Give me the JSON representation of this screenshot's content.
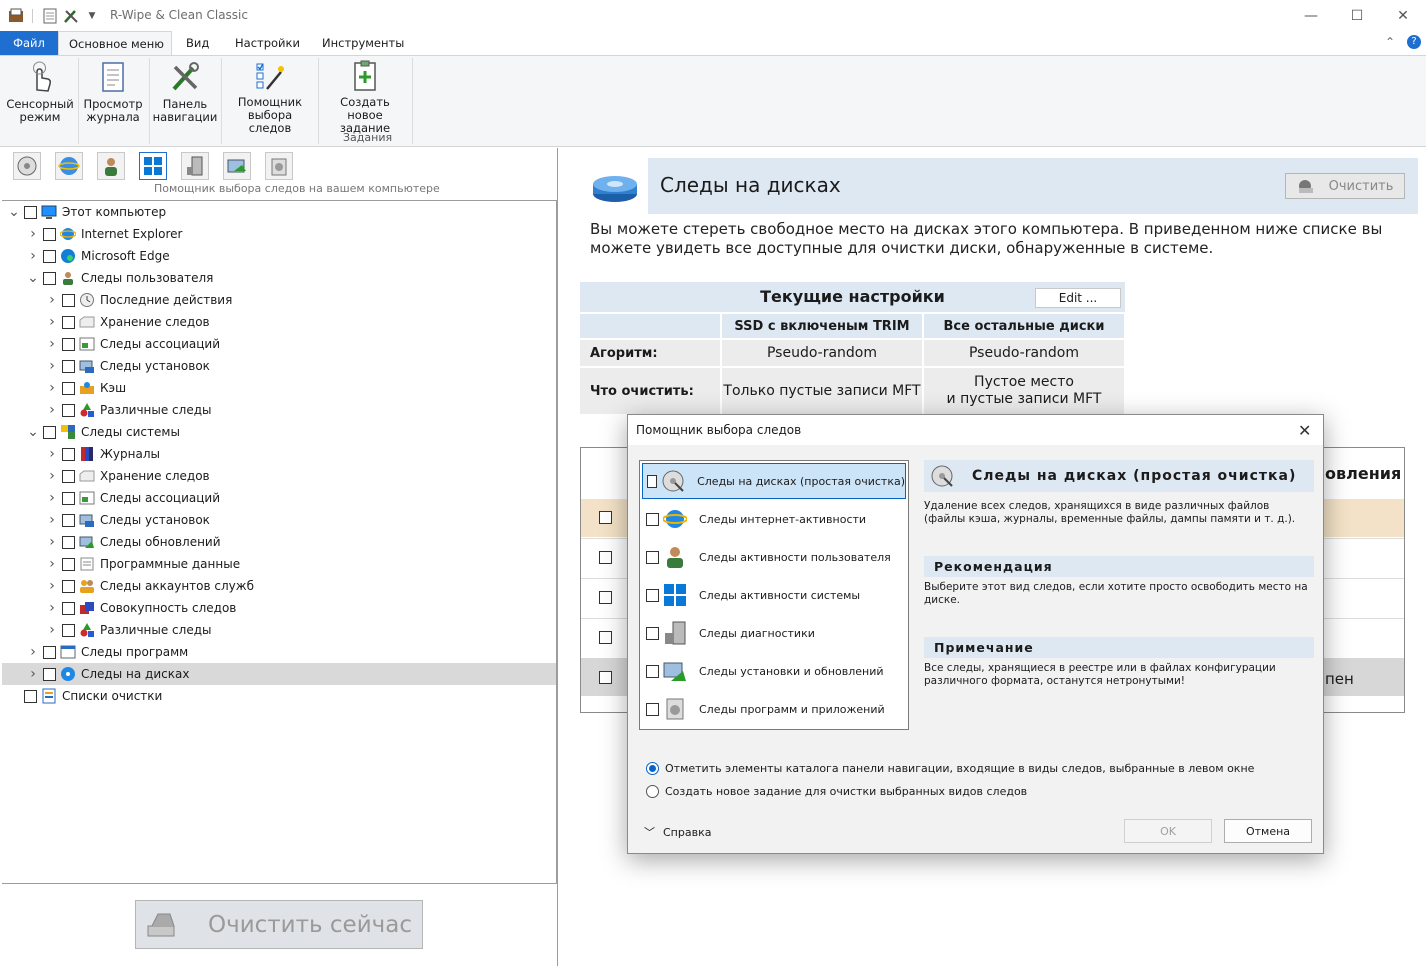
{
  "window": {
    "title": "R-Wipe & Clean Classic"
  },
  "ribbon_tabs": [
    "Файл",
    "Основное меню",
    "Вид",
    "Настройки",
    "Инструменты"
  ],
  "ribbon": {
    "buttons": [
      {
        "l1": "Сенсорный",
        "l2": "режим"
      },
      {
        "l1": "Просмотр",
        "l2": "журнала"
      },
      {
        "l1": "Панель",
        "l2": "навигации"
      },
      {
        "l1": "Помощник",
        "l2": "выбора следов"
      },
      {
        "l1": "Создать новое",
        "l2": "задание"
      }
    ],
    "group_label": "Задания"
  },
  "toolbar_hint": "Помощник выбора следов на вашем компьютере",
  "tree": [
    {
      "label": "Этот компьютер",
      "level": 0,
      "chev": "v",
      "icon": "monitor-icon"
    },
    {
      "label": "Internet  Explorer",
      "level": 1,
      "chev": ">",
      "icon": "ie-icon"
    },
    {
      "label": "Microsoft Edge",
      "level": 1,
      "chev": ">",
      "icon": "edge-icon"
    },
    {
      "label": "Следы пользователя",
      "level": 1,
      "chev": "v",
      "icon": "user-icon"
    },
    {
      "label": "Последние действия",
      "level": 2,
      "chev": ">",
      "icon": "clock-icon"
    },
    {
      "label": "Хранение следов",
      "level": 2,
      "chev": ">",
      "icon": "storage-icon"
    },
    {
      "label": "Следы ассоциаций",
      "level": 2,
      "chev": ">",
      "icon": "assoc-icon"
    },
    {
      "label": "Следы установок",
      "level": 2,
      "chev": ">",
      "icon": "install-icon"
    },
    {
      "label": "Кэш",
      "level": 2,
      "chev": ">",
      "icon": "cache-icon"
    },
    {
      "label": "Различные следы",
      "level": 2,
      "chev": ">",
      "icon": "misc-icon"
    },
    {
      "label": "Следы системы",
      "level": 1,
      "chev": "v",
      "icon": "system-icon"
    },
    {
      "label": "Журналы",
      "level": 2,
      "chev": ">",
      "icon": "logs-icon"
    },
    {
      "label": "Хранение следов",
      "level": 2,
      "chev": ">",
      "icon": "storage-icon"
    },
    {
      "label": "Следы ассоциаций",
      "level": 2,
      "chev": ">",
      "icon": "assoc-icon"
    },
    {
      "label": "Следы установок",
      "level": 2,
      "chev": ">",
      "icon": "install-icon"
    },
    {
      "label": "Следы обновлений",
      "level": 2,
      "chev": ">",
      "icon": "update-icon"
    },
    {
      "label": "Программные данные",
      "level": 2,
      "chev": ">",
      "icon": "progdata-icon"
    },
    {
      "label": "Следы аккаунтов служб",
      "level": 2,
      "chev": ">",
      "icon": "accounts-icon"
    },
    {
      "label": "Совокупность следов",
      "level": 2,
      "chev": ">",
      "icon": "aggregate-icon"
    },
    {
      "label": "Различные следы",
      "level": 2,
      "chev": ">",
      "icon": "misc-icon"
    },
    {
      "label": "Следы программ",
      "level": 1,
      "chev": ">",
      "icon": "programs-icon"
    },
    {
      "label": "Следы на дисках",
      "level": 1,
      "chev": ">",
      "icon": "disk-icon",
      "selected": true
    },
    {
      "label": "Списки очистки",
      "level": 0,
      "chev": "",
      "icon": "list-icon"
    }
  ],
  "clean_now": "Очистить сейчас",
  "right": {
    "title": "Следы на дисках",
    "clean_button": "Очистить",
    "description": "Вы можете стереть свободное место на дисках этого компьютера. В приведенном ниже списке вы можете увидеть все доступные для очистки диски, обнаруженные в системе.",
    "settings": {
      "heading": "Текущие настройки",
      "edit": "Edit ...",
      "col_ssd": "SSD с включеным TRIM",
      "col_other": "Все остальные диски",
      "row_algo": "Агоритм:",
      "algo_ssd": "Pseudo-random",
      "algo_other": "Pseudo-random",
      "row_what": "Что очистить:",
      "what_ssd": "Только пустые записи MFT",
      "what_other_l1": "Пустое место",
      "what_other_l2": "и пустые записи MFT"
    },
    "grid_partial_header": "овления",
    "grid_partial_row": "пен"
  },
  "dialog": {
    "title": "Помощник выбора следов",
    "items": [
      {
        "label": "Следы на дисках (простая очистка)",
        "icon": "disk-clean-icon",
        "selected": true
      },
      {
        "label": "Следы интернет-активности",
        "icon": "internet-icon"
      },
      {
        "label": "Следы активности пользователя",
        "icon": "user-icon"
      },
      {
        "label": "Следы активности системы",
        "icon": "windows-icon"
      },
      {
        "label": "Следы диагностики",
        "icon": "diagnostics-icon"
      },
      {
        "label": "Следы установки и обновлений",
        "icon": "install-update-icon"
      },
      {
        "label": "Следы программ и приложений",
        "icon": "apps-icon"
      }
    ],
    "info_title": "Следы на дисках (простая очистка)",
    "info_desc": "Удаление всех следов, хранящихся в виде различных файлов (файлы кэша, журналы, временные файлы, дампы памяти и т. д.).",
    "rec_title": "Рекомендация",
    "rec_text": "Выберите этот вид следов, если хотите просто освободить место на диске.",
    "note_title": "Примечание",
    "note_text": "Все следы, хранящиеся в реестре или в файлах конфигурации различного формата, останутся нетронутыми!",
    "radio1": "Отметить элементы каталога панели навигации, входящие в виды следов, выбранные в левом окне",
    "radio2": "Создать новое задание для очистки выбранных видов следов",
    "help": "Справка",
    "ok": "OK",
    "cancel": "Отмена"
  }
}
